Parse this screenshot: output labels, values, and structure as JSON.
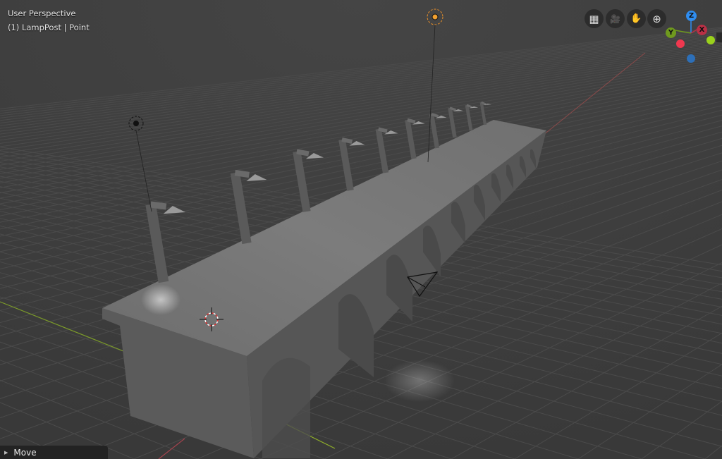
{
  "viewport": {
    "view_name": "User Perspective",
    "object_info": "(1) LampPost | Point"
  },
  "navigation": {
    "buttons": [
      {
        "name": "toggle-grid-view",
        "icon": "grid-icon",
        "glyph": "▦"
      },
      {
        "name": "camera-view",
        "icon": "camera-icon",
        "glyph": "🎥"
      },
      {
        "name": "pan-view",
        "icon": "hand-icon",
        "glyph": "✋"
      },
      {
        "name": "zoom-view",
        "icon": "zoom-icon",
        "glyph": "⊕"
      }
    ],
    "gizmo": {
      "z_label": "Z",
      "y_label": "Y",
      "x_label": "X",
      "colors": {
        "z": "#2f8df0",
        "y": "#6f9a1e",
        "x": "#b83045",
        "neg_x": "#f0384f",
        "neg_y": "#9ad11c",
        "neg_z": "#2d6fb8"
      }
    }
  },
  "operator_panel": {
    "label": "Move"
  }
}
